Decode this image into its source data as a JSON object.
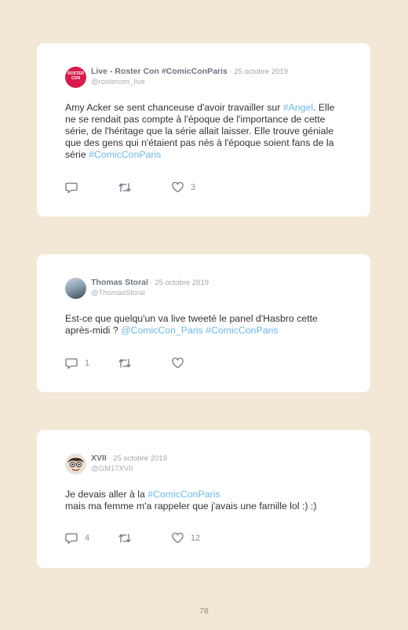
{
  "page_number": "78",
  "colors": {
    "background": "#f3e8d5",
    "card": "#ffffff",
    "link": "#6bb8e6",
    "name": "#6b7580"
  },
  "tweets": [
    {
      "name": "Live - Roster Con #ComicConParis",
      "date": " · 25 octobre 2019",
      "handle": "@rostercon_live",
      "avatar_text_1": "ROSTER",
      "avatar_text_2": "CON",
      "text_1": "Amy Acker se sent chanceuse d'avoir travailler sur ",
      "link_1": "#Angel",
      "text_2": ". Elle ne se rendait pas compte à l'époque de l'importance de cette série, de l'héritage que la série allait laisser. Elle trouve géniale que des gens qui n'étaient pas nés à l'époque soient fans de la série ",
      "link_2": "#ComicConParis",
      "replies": "",
      "likes": "3"
    },
    {
      "name": "Thomas Storaï",
      "date": " · 25 octobre 2019",
      "handle": "@ThomasStorai",
      "text_1": "Est-ce que quelqu'un va live tweeté le panel d'Hasbro cette après-midi ? ",
      "link_1": "@ComicCon_Paris",
      "link_2": "#ComicConParis",
      "replies": "1",
      "likes": ""
    },
    {
      "name": "XVII",
      "date": " · 25 octobre 2019",
      "handle": "@GM17XVII",
      "text_1": "Je devais aller à la ",
      "link_1": "#ComicConParis",
      "text_2": "mais ma femme m'a rappeler que j'avais une famille lol :) :)",
      "replies": "4",
      "likes": "12"
    }
  ]
}
